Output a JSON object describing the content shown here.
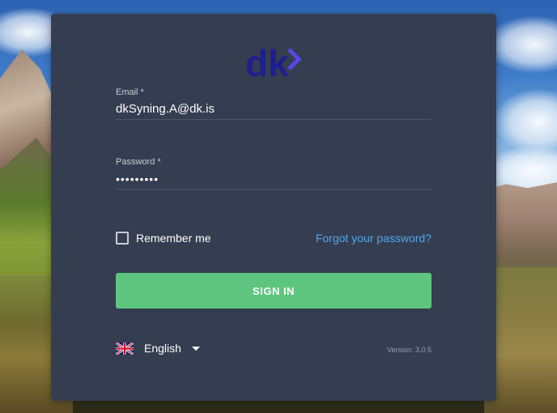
{
  "app": {
    "logo_text": "dk",
    "brand_color": "#1f1f8f",
    "accent_arrow_color": "#5a46e8"
  },
  "login": {
    "email_label": "Email *",
    "email_value": "dkSyning.A@dk.is",
    "password_label": "Password *",
    "password_value": "•••••••••",
    "remember_label": "Remember me",
    "remember_checked": false,
    "forgot_link": "Forgot your password?",
    "signin_label": "SIGN IN"
  },
  "footer": {
    "language": "English",
    "language_flag_icon": "uk-flag-icon",
    "version": "Version: 3.0.5"
  },
  "colors": {
    "card_bg": "#353d51",
    "button_green": "#5ec57f",
    "link_blue": "#4fa8ee"
  }
}
